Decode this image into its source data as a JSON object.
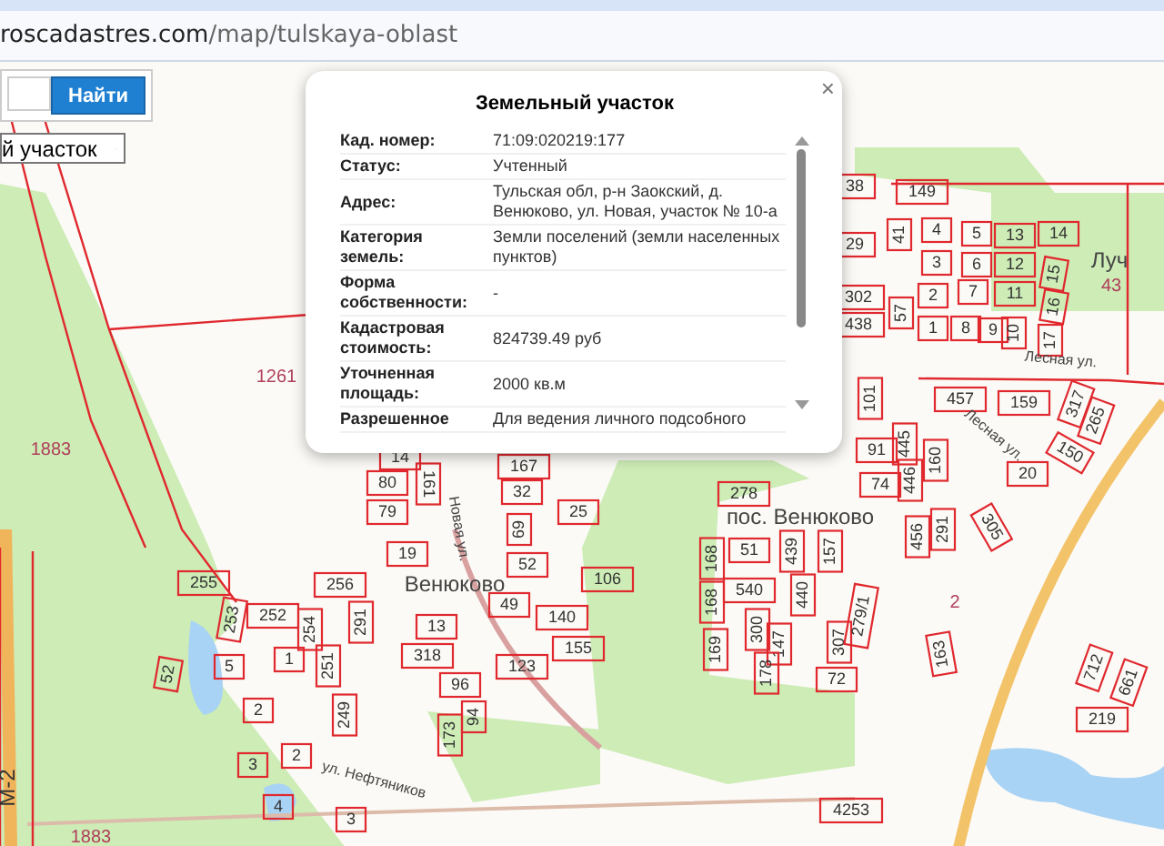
{
  "browser": {
    "url_domain": "roscadastres.com",
    "url_path": "/map/tulskaya-oblast"
  },
  "search": {
    "button": "Найти",
    "layer_select": "й участок"
  },
  "popup": {
    "title": "Земельный участок",
    "close": "×",
    "rows": [
      {
        "label": "Кад. номер:",
        "value": "71:09:020219:177"
      },
      {
        "label": "Статус:",
        "value": "Учтенный"
      },
      {
        "label": "Адрес:",
        "value": "Тульская обл, р-н Заокский, д. Венюково, ул. Новая, участок № 10-а"
      },
      {
        "label": "Категория земель:",
        "value": "Земли поселений (земли населенных пунктов)"
      },
      {
        "label": "Форма собственности:",
        "value": "-"
      },
      {
        "label": "Кадастровая стоимость:",
        "value": "824739.49 руб"
      },
      {
        "label": "Уточненная площадь:",
        "value": "2000 кв.м"
      },
      {
        "label": "Разрешенное",
        "value": "Для ведения личного подсобного"
      }
    ]
  },
  "map": {
    "labels": [
      {
        "text": "1261",
        "kind": "area"
      },
      {
        "text": "1883",
        "kind": "area"
      },
      {
        "text": "1883",
        "kind": "area"
      },
      {
        "text": "М-2",
        "kind": "road"
      },
      {
        "text": "149",
        "kind": "parcel"
      },
      {
        "text": "38",
        "kind": "parcel"
      },
      {
        "text": "41",
        "kind": "parcel"
      },
      {
        "text": "4",
        "kind": "parcel"
      },
      {
        "text": "5",
        "kind": "parcel"
      },
      {
        "text": "13",
        "kind": "parcel"
      },
      {
        "text": "14",
        "kind": "parcel"
      },
      {
        "text": "3",
        "kind": "parcel"
      },
      {
        "text": "6",
        "kind": "parcel"
      },
      {
        "text": "12",
        "kind": "parcel"
      },
      {
        "text": "15",
        "kind": "parcel"
      },
      {
        "text": "2",
        "kind": "parcel"
      },
      {
        "text": "7",
        "kind": "parcel"
      },
      {
        "text": "11",
        "kind": "parcel"
      },
      {
        "text": "16",
        "kind": "parcel"
      },
      {
        "text": "1",
        "kind": "parcel"
      },
      {
        "text": "8",
        "kind": "parcel"
      },
      {
        "text": "9",
        "kind": "parcel"
      },
      {
        "text": "10",
        "kind": "parcel"
      },
      {
        "text": "17",
        "kind": "parcel"
      },
      {
        "text": "57",
        "kind": "parcel"
      },
      {
        "text": "29",
        "kind": "parcel"
      },
      {
        "text": "302",
        "kind": "parcel"
      },
      {
        "text": "438",
        "kind": "parcel"
      },
      {
        "text": "Луч",
        "kind": "place"
      },
      {
        "text": "43",
        "kind": "area"
      },
      {
        "text": "Лесная ул.",
        "kind": "street"
      },
      {
        "text": "101",
        "kind": "parcel"
      },
      {
        "text": "457",
        "kind": "parcel"
      },
      {
        "text": "159",
        "kind": "parcel"
      },
      {
        "text": "317",
        "kind": "parcel"
      },
      {
        "text": "265",
        "kind": "parcel"
      },
      {
        "text": "Лесная ул.",
        "kind": "street"
      },
      {
        "text": "91",
        "kind": "parcel"
      },
      {
        "text": "445",
        "kind": "parcel"
      },
      {
        "text": "446",
        "kind": "parcel"
      },
      {
        "text": "160",
        "kind": "parcel"
      },
      {
        "text": "20",
        "kind": "parcel"
      },
      {
        "text": "150",
        "kind": "parcel"
      },
      {
        "text": "74",
        "kind": "parcel"
      },
      {
        "text": "278",
        "kind": "parcel"
      },
      {
        "text": "пос. Венюково",
        "kind": "place"
      },
      {
        "text": "456",
        "kind": "parcel"
      },
      {
        "text": "291",
        "kind": "parcel"
      },
      {
        "text": "305",
        "kind": "parcel"
      },
      {
        "text": "168",
        "kind": "parcel"
      },
      {
        "text": "51",
        "kind": "parcel"
      },
      {
        "text": "439",
        "kind": "parcel"
      },
      {
        "text": "157",
        "kind": "parcel"
      },
      {
        "text": "168",
        "kind": "parcel"
      },
      {
        "text": "540",
        "kind": "parcel"
      },
      {
        "text": "440",
        "kind": "parcel"
      },
      {
        "text": "169",
        "kind": "parcel"
      },
      {
        "text": "300",
        "kind": "parcel"
      },
      {
        "text": "147",
        "kind": "parcel"
      },
      {
        "text": "307",
        "kind": "parcel"
      },
      {
        "text": "279/1",
        "kind": "parcel"
      },
      {
        "text": "178",
        "kind": "parcel"
      },
      {
        "text": "2",
        "kind": "area"
      },
      {
        "text": "72",
        "kind": "parcel"
      },
      {
        "text": "163",
        "kind": "parcel"
      },
      {
        "text": "712",
        "kind": "parcel"
      },
      {
        "text": "661",
        "kind": "parcel"
      },
      {
        "text": "219",
        "kind": "parcel"
      },
      {
        "text": "4253",
        "kind": "parcel"
      },
      {
        "text": "255",
        "kind": "parcel"
      },
      {
        "text": "256",
        "kind": "parcel"
      },
      {
        "text": "253",
        "kind": "parcel"
      },
      {
        "text": "252",
        "kind": "parcel"
      },
      {
        "text": "254",
        "kind": "parcel"
      },
      {
        "text": "291",
        "kind": "parcel"
      },
      {
        "text": "19",
        "kind": "parcel"
      },
      {
        "text": "Венюково",
        "kind": "place"
      },
      {
        "text": "13",
        "kind": "parcel"
      },
      {
        "text": "52",
        "kind": "parcel"
      },
      {
        "text": "49",
        "kind": "parcel"
      },
      {
        "text": "140",
        "kind": "parcel"
      },
      {
        "text": "5",
        "kind": "parcel"
      },
      {
        "text": "1",
        "kind": "parcel"
      },
      {
        "text": "251",
        "kind": "parcel"
      },
      {
        "text": "318",
        "kind": "parcel"
      },
      {
        "text": "123",
        "kind": "parcel"
      },
      {
        "text": "155",
        "kind": "parcel"
      },
      {
        "text": "52",
        "kind": "parcel"
      },
      {
        "text": "2",
        "kind": "parcel"
      },
      {
        "text": "249",
        "kind": "parcel"
      },
      {
        "text": "96",
        "kind": "parcel"
      },
      {
        "text": "94",
        "kind": "parcel"
      },
      {
        "text": "173",
        "kind": "parcel"
      },
      {
        "text": "3",
        "kind": "parcel"
      },
      {
        "text": "2",
        "kind": "parcel"
      },
      {
        "text": "4",
        "kind": "parcel"
      },
      {
        "text": "3",
        "kind": "parcel"
      },
      {
        "text": "ул. Нефтяников",
        "kind": "street"
      },
      {
        "text": "14",
        "kind": "parcel"
      },
      {
        "text": "80",
        "kind": "parcel"
      },
      {
        "text": "161",
        "kind": "parcel"
      },
      {
        "text": "167",
        "kind": "parcel"
      },
      {
        "text": "32",
        "kind": "parcel"
      },
      {
        "text": "79",
        "kind": "parcel"
      },
      {
        "text": "25",
        "kind": "parcel"
      },
      {
        "text": "69",
        "kind": "parcel"
      },
      {
        "text": "106",
        "kind": "parcel"
      },
      {
        "text": "Новая ул.",
        "kind": "street"
      }
    ]
  }
}
